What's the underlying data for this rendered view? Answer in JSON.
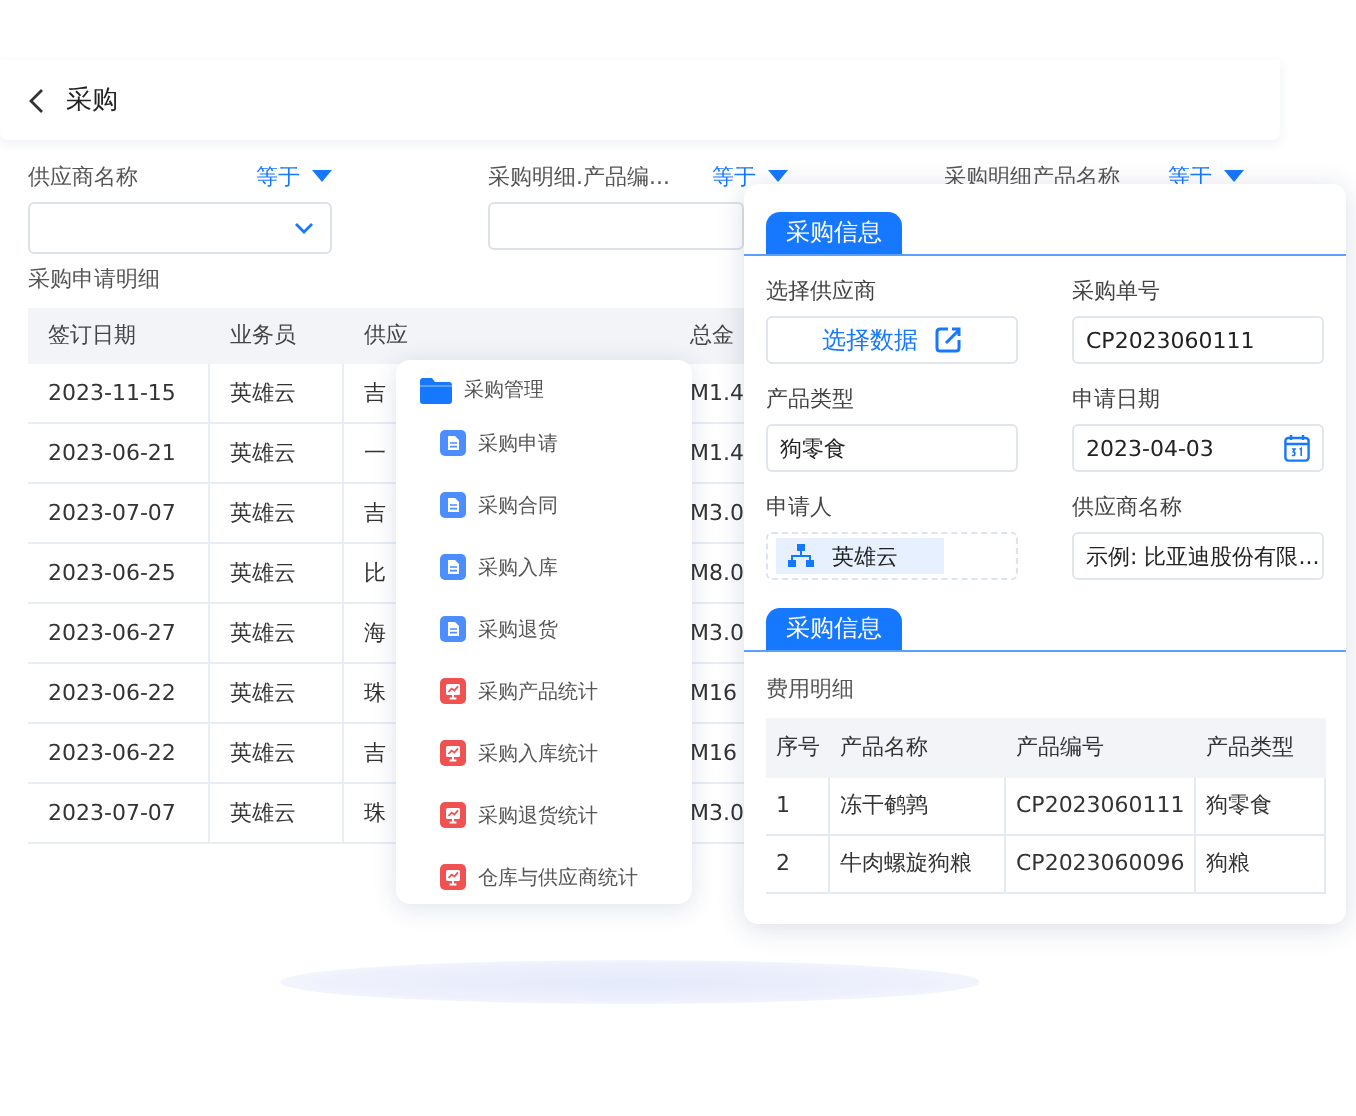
{
  "header": {
    "title": "采购"
  },
  "filters": [
    {
      "label": "供应商名称",
      "operator": "等于",
      "kind": "select"
    },
    {
      "label": "采购明细.产品编...",
      "operator": "等于",
      "kind": "text"
    },
    {
      "label": "采购明细产品名称",
      "operator": "等于",
      "kind": "label"
    }
  ],
  "table": {
    "title": "采购申请明细",
    "columns": [
      "签订日期",
      "业务员",
      "供应",
      "总金"
    ],
    "rows": [
      [
        "2023-11-15",
        "英雄云",
        "吉",
        "M1.4"
      ],
      [
        "2023-06-21",
        "英雄云",
        "一",
        "M1.4"
      ],
      [
        "2023-07-07",
        "英雄云",
        "吉",
        "M3.0"
      ],
      [
        "2023-06-25",
        "英雄云",
        "比",
        "M8.0"
      ],
      [
        "2023-06-27",
        "英雄云",
        "海",
        "M3.0"
      ],
      [
        "2023-06-22",
        "英雄云",
        "珠",
        "M16"
      ],
      [
        "2023-06-22",
        "英雄云",
        "吉",
        "M16"
      ],
      [
        "2023-07-07",
        "英雄云",
        "珠",
        "M3.0"
      ]
    ]
  },
  "menu": {
    "title": "采购管理",
    "items": [
      {
        "label": "采购申请",
        "kind": "page"
      },
      {
        "label": "采购合同",
        "kind": "page"
      },
      {
        "label": "采购入库",
        "kind": "page"
      },
      {
        "label": "采购退货",
        "kind": "page"
      },
      {
        "label": "采购产品统计",
        "kind": "report"
      },
      {
        "label": "采购入库统计",
        "kind": "report"
      },
      {
        "label": "采购退货统计",
        "kind": "report"
      },
      {
        "label": "仓库与供应商统计",
        "kind": "report"
      }
    ]
  },
  "form_panel": {
    "sections": [
      {
        "tab": "采购信息",
        "fields": [
          {
            "label": "选择供应商",
            "kind": "picker",
            "value": "选择数据"
          },
          {
            "label": "采购单号",
            "kind": "text",
            "value": "CP2023060111"
          },
          {
            "label": "产品类型",
            "kind": "text",
            "value": "狗零食"
          },
          {
            "label": "申请日期",
            "kind": "date",
            "value": "2023-04-03"
          },
          {
            "label": "申请人",
            "kind": "user",
            "value": "英雄云"
          },
          {
            "label": "供应商名称",
            "kind": "text",
            "value": "示例: 比亚迪股份有限..."
          }
        ]
      },
      {
        "tab": "采购信息",
        "subtitle": "费用明细",
        "columns": [
          "序号",
          "产品名称",
          "产品编号",
          "产品类型"
        ],
        "rows": [
          [
            "1",
            "冻干鹌鹑",
            "CP2023060111",
            "狗零食"
          ],
          [
            "2",
            "牛肉螺旋狗粮",
            "CP2023060096",
            "狗粮"
          ]
        ]
      }
    ]
  }
}
